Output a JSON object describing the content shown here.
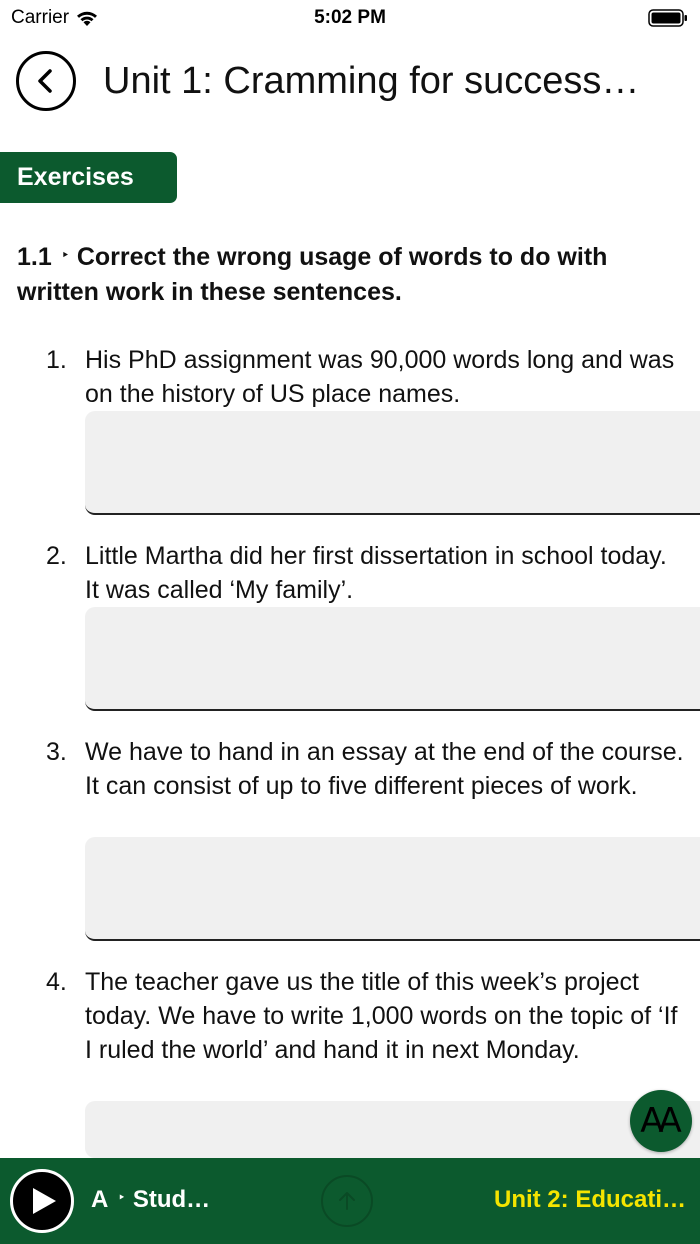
{
  "status_bar": {
    "carrier": "Carrier",
    "time": "5:02 PM",
    "icons": [
      "wifi-icon",
      "battery-icon"
    ]
  },
  "header": {
    "title": "Unit 1: Cramming for success…",
    "back_icon": "chevron-left-icon"
  },
  "section_tab": {
    "label": "Exercises"
  },
  "exercise": {
    "number": "1.1",
    "arrow": "‣",
    "instruction": "Correct the wrong usage of words to do with written work in these sentences.",
    "questions": [
      {
        "num": "1.",
        "text": "His PhD assignment was 90,000 words long and was on the history of US place names.",
        "answer": ""
      },
      {
        "num": "2.",
        "text": "Little Martha did her first dissertation in school today. It was called ‘My family’.",
        "answer": ""
      },
      {
        "num": "3.",
        "text": "We have to hand in an essay at the end of the course. It can consist of up to five different pieces of work.",
        "answer": ""
      },
      {
        "num": "4.",
        "text": "The teacher gave us the title of this week’s project today. We have to write 1,000 words on the topic of ‘If I ruled the world’ and hand it in next Monday.",
        "answer": ""
      }
    ]
  },
  "font_size_button": {
    "label": "AA"
  },
  "bottom_bar": {
    "previous_prefix": "A",
    "previous_arrow": "‣",
    "previous_label": "Stud…",
    "next_label": "Unit 2: Educati…",
    "colors": {
      "background": "#0c5a2e",
      "next_label": "#f5e400"
    }
  }
}
